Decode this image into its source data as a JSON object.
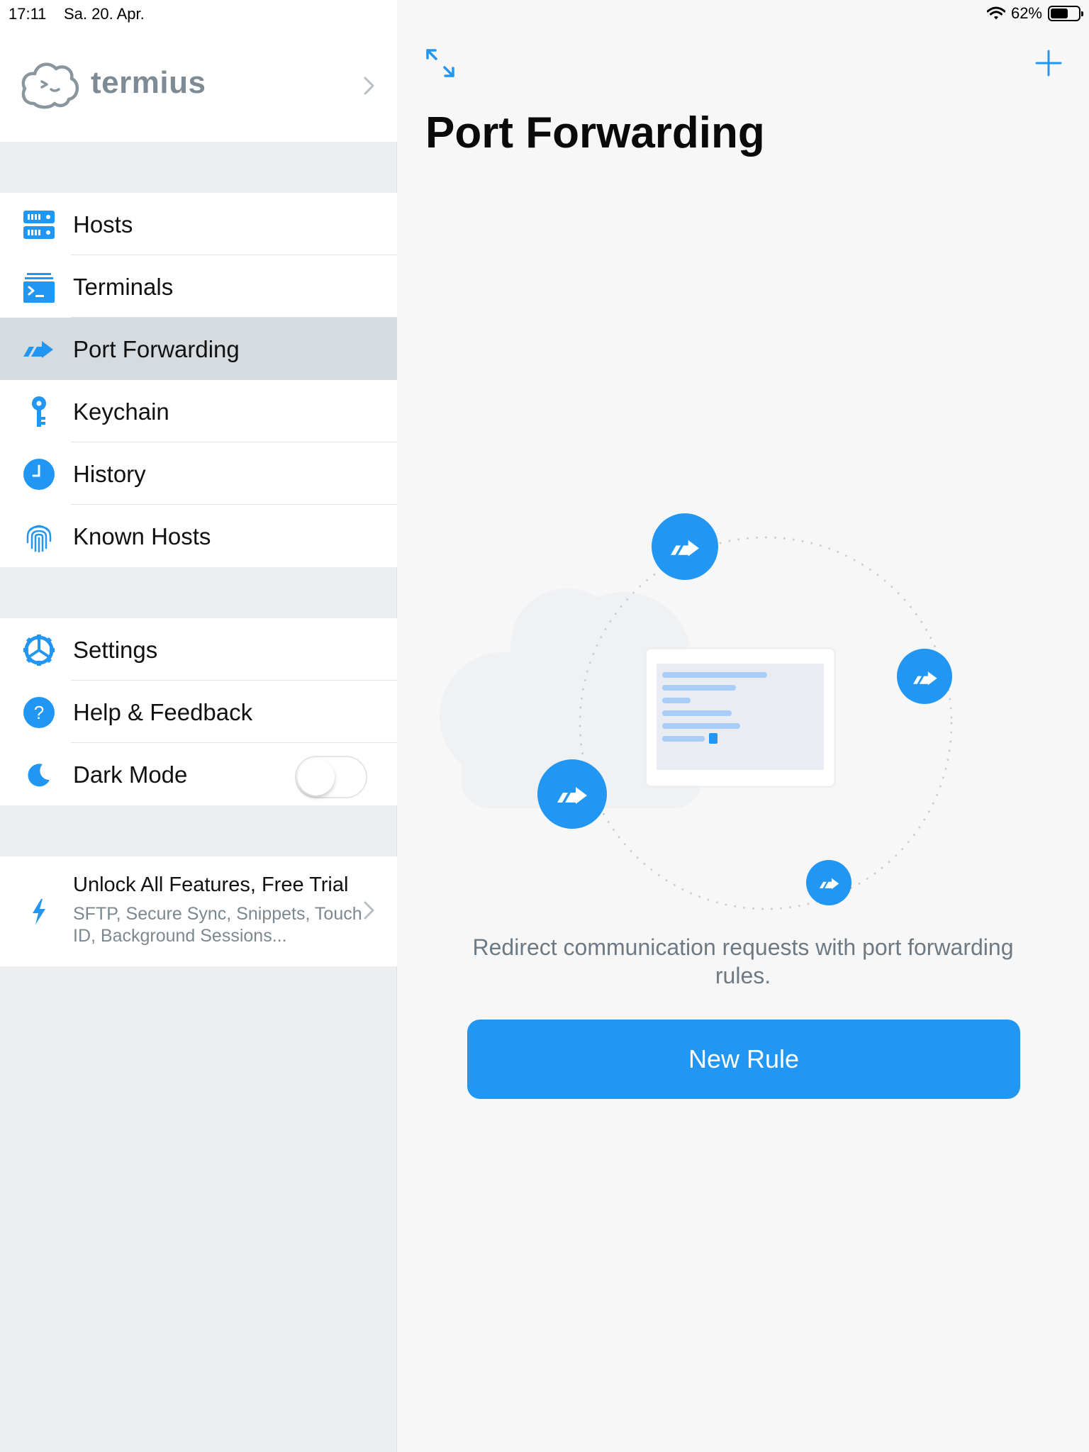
{
  "status_bar": {
    "time": "17:11",
    "date": "Sa. 20. Apr.",
    "battery_percent": "62%",
    "battery_level": 0.62
  },
  "colors": {
    "accent": "#2196f3",
    "sidebar_bg": "#eceef0",
    "active_row": "#d5dbdf",
    "muted_text": "#7c8890"
  },
  "brand": {
    "name": "termius",
    "icon": "cloud-terminal-logo"
  },
  "sidebar": {
    "nav_items": [
      {
        "label": "Hosts",
        "icon": "server-icon"
      },
      {
        "label": "Terminals",
        "icon": "terminal-icon"
      },
      {
        "label": "Port Forwarding",
        "icon": "port-forwarding-icon",
        "active": true
      },
      {
        "label": "Keychain",
        "icon": "key-icon"
      },
      {
        "label": "History",
        "icon": "clock-icon"
      },
      {
        "label": "Known Hosts",
        "icon": "fingerprint-icon"
      }
    ],
    "settings_items": [
      {
        "label": "Settings",
        "icon": "gear-icon"
      },
      {
        "label": "Help & Feedback",
        "icon": "question-icon"
      },
      {
        "label": "Dark Mode",
        "icon": "moon-icon",
        "toggle_on": false
      }
    ],
    "promo": {
      "title": "Unlock All Features, Free Trial",
      "subtitle": "SFTP, Secure Sync, Snippets, Touch ID, Background Sessions...",
      "icon": "bolt-icon"
    }
  },
  "main": {
    "title": "Port Forwarding",
    "toolbar": {
      "left_icon": "expand-icon",
      "right_icon": "plus-icon"
    },
    "empty_state_text": "Redirect communication requests with port forwarding rules.",
    "new_rule_label": "New Rule"
  }
}
